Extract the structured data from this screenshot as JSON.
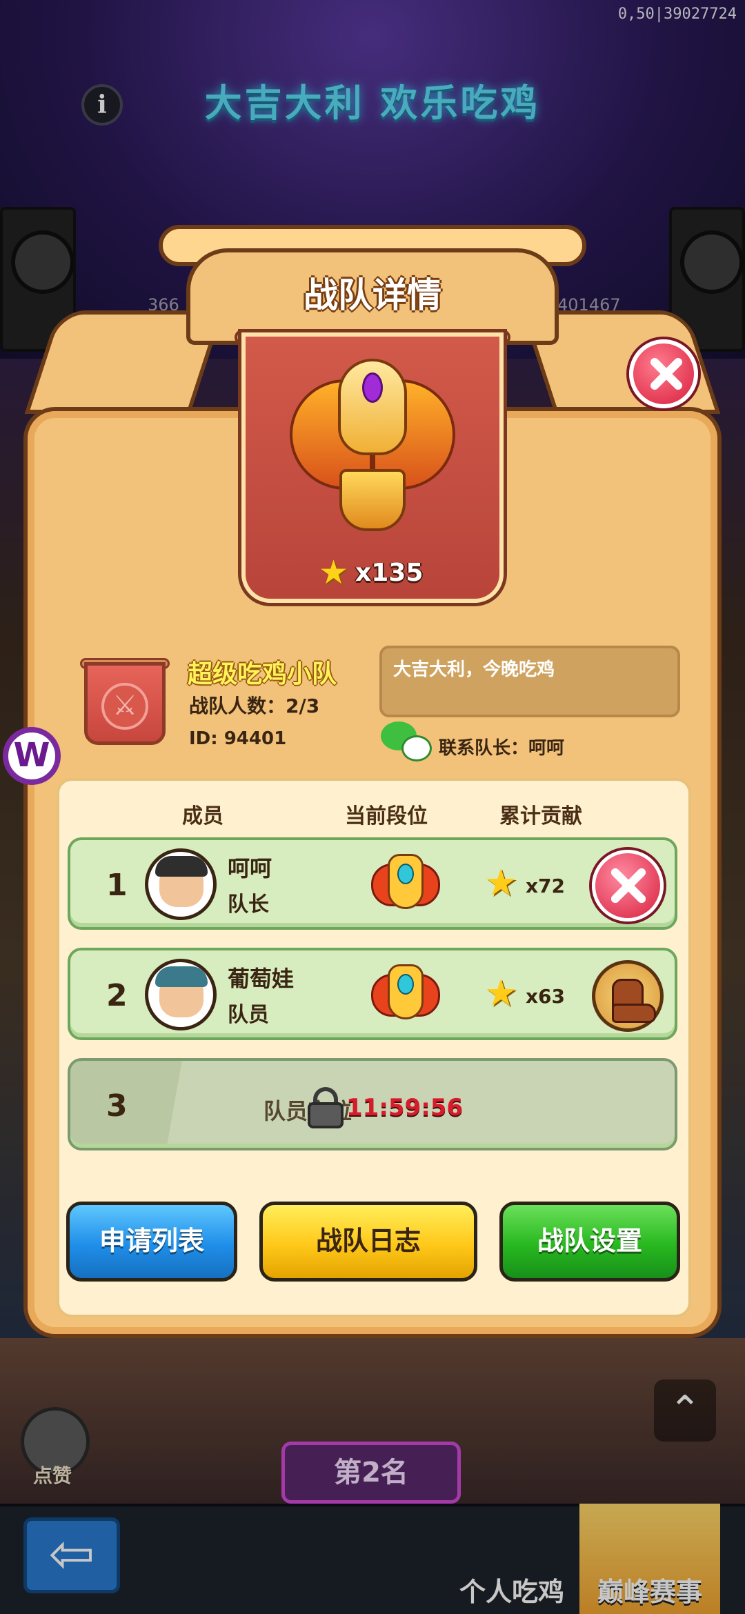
{
  "background": {
    "event_banner": "大吉大利 欢乐吃鸡",
    "top_right_text": "0,50|39027724",
    "left_count": "366",
    "right_count": "401467",
    "like_label": "点赞",
    "rank_tag": "第2名",
    "tabs": [
      "个人吃鸡",
      "巅峰赛事"
    ]
  },
  "dialog": {
    "title": "战队详情",
    "trophy_stars": "x135",
    "team": {
      "name": "超级吃鸡小队",
      "member_count": "战队人数：2/3",
      "id": "ID: 94401",
      "motto": "大吉大利，今晚吃鸡",
      "contact": "联系队长：呵呵"
    },
    "columns": [
      "成员",
      "当前段位",
      "累计贡献"
    ],
    "members": [
      {
        "rank": "1",
        "name": "呵呵",
        "role": "队长",
        "contribution": "x72"
      },
      {
        "rank": "2",
        "name": "葡萄娃",
        "role": "队员",
        "contribution": "x63"
      }
    ],
    "locked_slot": {
      "rank": "3",
      "label": "队员空位",
      "timer": "11:59:56"
    },
    "buttons": {
      "apply_list": "申请列表",
      "team_log": "战队日志",
      "team_settings": "战队设置"
    }
  },
  "colors": {
    "panel": "#f2c27a",
    "panel_border": "#6b3c17",
    "member_row": "#d7edc0",
    "close_red": "#d81f3d",
    "blue_button": "#1f8ee8",
    "yellow_button": "#ffc81a",
    "green_button": "#28b81f"
  },
  "icons": [
    "info-icon",
    "close-icon",
    "star-icon",
    "wechat-icon",
    "lock-icon",
    "boot-icon",
    "tier-badge-icon",
    "back-arrow-icon",
    "like-icon",
    "chevron-up-icon"
  ]
}
